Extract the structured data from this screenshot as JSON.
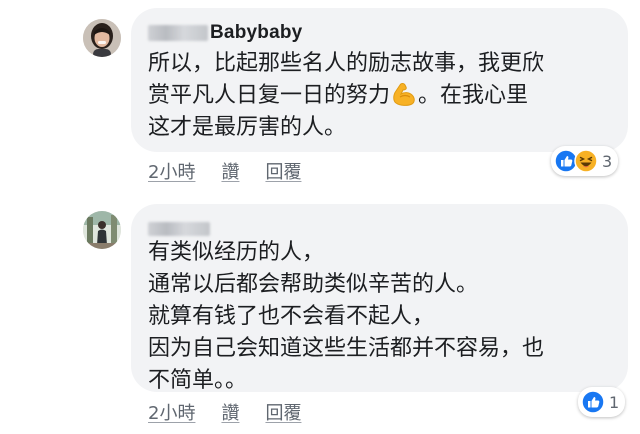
{
  "comments": [
    {
      "author_visible": "Babybaby",
      "text_lines": [
        "所以，比起那些名人的励志故事，我更欣",
        "赏平凡人日复一日的努力",
        "。在我心里",
        "这才是最厉害的人。"
      ],
      "inline_emoji": "flexed-biceps-icon",
      "time": "2小時",
      "like_label": "讚",
      "reply_label": "回覆",
      "reactions": [
        "like-icon",
        "haha-icon"
      ],
      "reaction_count": "3"
    },
    {
      "author_visible": "",
      "text": "有类似经历的人，\n通常以后都会帮助类似辛苦的人。\n就算有钱了也不会看不起人，\n因为自己会知道这些生活都并不容易，也\n不简单。。",
      "time": "2小時",
      "like_label": "讚",
      "reply_label": "回覆",
      "reactions": [
        "like-icon"
      ],
      "reaction_count": "1"
    }
  ],
  "colors": {
    "bubble": "#f2f3f5",
    "text": "#1c1e21",
    "meta": "#606770",
    "like_blue": "#1877f2",
    "haha_yellow": "#f7b125"
  }
}
